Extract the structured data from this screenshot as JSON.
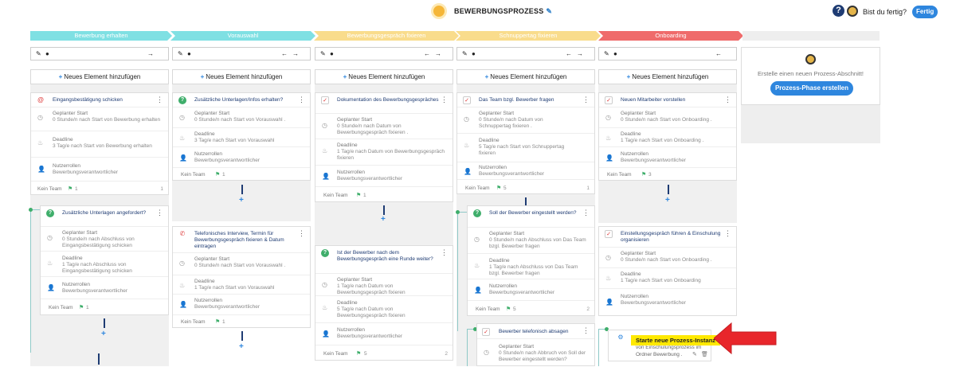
{
  "header": {
    "title": "BEWERBUNGSPROZESS",
    "help": "?",
    "done_question": "Bist du fertig?",
    "done_button": "Fertig"
  },
  "phases": [
    {
      "label": "Bewerbung erhalten",
      "color": "#7fe0e3"
    },
    {
      "label": "Vorauswahl",
      "color": "#7fe0e3"
    },
    {
      "label": "Bewerbungsgespräch fixieren",
      "color": "#f9dc8c"
    },
    {
      "label": "Schnuppertag fixieren",
      "color": "#f9dc8c"
    },
    {
      "label": "Onboarding",
      "color": "#ef6b6b"
    }
  ],
  "add_element": "Neues Element hinzufügen",
  "labels": {
    "start": "Geplanter Start",
    "deadline": "Deadline",
    "roles": "Nutzerrollen",
    "no_team": "Kein Team"
  },
  "new_section": {
    "text": "Erstelle einen neuen Prozess-Abschnitt!",
    "button": "Prozess-Phase erstellen"
  },
  "cards": {
    "c1a": {
      "title": "Eingangsbestätigung schicken",
      "start": "0 Stunde/n nach Start von Bewerbung erhalten",
      "deadline": "3 Tag/e nach Start von Bewerbung erhalten",
      "roles": "Bewerbungsverantwortlicher",
      "flags": "1",
      "pager": "1"
    },
    "c1b": {
      "title": "Zusätzliche Unterlagen angefordert?",
      "start": "0 Stunde/n nach Abschluss von Eingangsbestätigung schicken",
      "deadline": "1 Tag/e nach Abschluss von Eingangsbestätigung schicken",
      "roles": "Bewerbungsverantwortlicher",
      "flags": "1"
    },
    "c2a": {
      "title": "Zusätzliche Unterlagen/Infos erhalten?",
      "start": "0 Stunde/n nach Start von Vorauswahl .",
      "deadline": "3 Tag/e nach Start von Vorauswahl",
      "roles": "Bewerbungsverantwortlicher",
      "flags": "1"
    },
    "c2b": {
      "title": "Telefonisches Interview, Termin für Bewerbungsgespräch fixieren & Datum eintragen",
      "start": "0 Stunde/n nach Start von Vorauswahl .",
      "deadline": "1 Tag/e nach Start von Vorauswahl",
      "roles": "Bewerbungsverantwortlicher",
      "flags": "1"
    },
    "c3a": {
      "title": "Dokumentation des Bewerbungsgespräches",
      "start": "0 Stunde/n nach Datum von Bewerbungsgespräch fixieren .",
      "deadline": "1 Tag/e nach Datum von Bewerbungsgespräch fixieren",
      "roles": "Bewerbungsverantwortlicher",
      "flags": "1"
    },
    "c3b": {
      "title": "Ist der Bewerber nach dem Bewerbungsgespräch eine Runde weiter?",
      "start": "1 Tag/e nach Datum von Bewerbungsgespräch fixieren",
      "deadline": "5 Tag/e nach Datum von Bewerbungsgespräch fixieren",
      "roles": "Bewerbungsverantwortlicher",
      "flags": "5",
      "pager": "2"
    },
    "c4a": {
      "title": "Das Team bzgl. Bewerber fragen",
      "start": "0 Stunde/n nach Datum von Schnuppertag fixieren .",
      "deadline": "5 Tag/e nach Start von Schnuppertag fixieren",
      "roles": "Bewerbungsverantwortlicher",
      "flags": "5",
      "pager": "1"
    },
    "c4b": {
      "title": "Soll der Bewerber eingestellt werden?",
      "start": "0 Stunde/n nach Abschluss von Das Team bzgl. Bewerber fragen",
      "deadline": "1 Tag/e nach Abschluss von Das Team bzgl. Bewerber fragen",
      "roles": "Bewerbungsverantwortlicher",
      "flags": "5",
      "pager": "2"
    },
    "c4c": {
      "title": "Bewerber telefonisch absagen",
      "start": "0 Stunde/n nach Abbruch von Soll der Bewerber eingestellt werden?"
    },
    "c5a": {
      "title": "Neuen Mitarbeiter vorstellen",
      "start": "0 Stunde/n nach Start von Onboarding .",
      "deadline": "1 Tag/e nach Start von Onboarding .",
      "roles": "Bewerbungsverantwortlicher",
      "flags": "3"
    },
    "c5b": {
      "title": "Einstellungsgespräch führen & Einschulung organisieren",
      "start": "0 Stunde/n nach Start von Onboarding .",
      "deadline": "1 Tag/e nach Start von Onboarding",
      "roles": "Bewerbungsverantwortlicher"
    },
    "c5c": {
      "highlight": "Starte neue Prozess-Instanz",
      "line1": "von Einschulungsprozess im",
      "line2": "Ordner Bewerbung ."
    }
  }
}
